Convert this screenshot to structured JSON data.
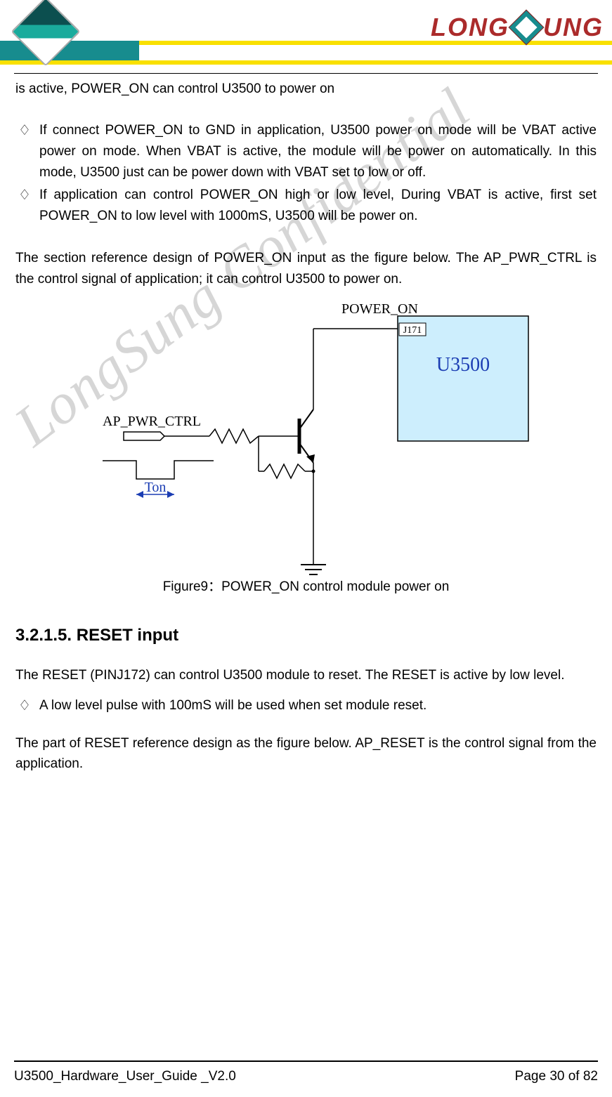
{
  "header": {
    "brand_left": "LONG",
    "brand_right": "UNG"
  },
  "content": {
    "intro_line": "is active, POWER_ON can control U3500 to power on",
    "bullets_top": [
      "If connect POWER_ON to GND in application, U3500 power on mode will be VBAT active power on mode. When VBAT is active, the module will be power on automatically. In this mode, U3500 just can be power down with VBAT set to low or off.",
      "If application can control POWER_ON high or low level, During VBAT is active, first set POWER_ON to low level with 1000mS, U3500 will be power on."
    ],
    "ref_para": "The section reference design of POWER_ON input as the figure below. The AP_PWR_CTRL is the control signal of application; it can control U3500 to power on.",
    "fig": {
      "signal": "AP_PWR_CTRL",
      "ton": "Ton",
      "net": "POWER_ON",
      "pin": "J171",
      "module": "U3500",
      "caption": "Figure9：POWER_ON control module power on"
    },
    "section_heading": "3.2.1.5. RESET input",
    "reset_para1": "The RESET (PINJ172) can control U3500 module to reset. The RESET is active by low level.",
    "bullets_reset": [
      "A low level pulse with 100mS will be used when set module reset."
    ],
    "reset_para2": "The part of RESET reference design as the figure below. AP_RESET is the control signal from the application."
  },
  "watermark": "LongSung Confidential",
  "footer": {
    "doc": "U3500_Hardware_User_Guide _V2.0",
    "page": "Page 30 of 82"
  }
}
